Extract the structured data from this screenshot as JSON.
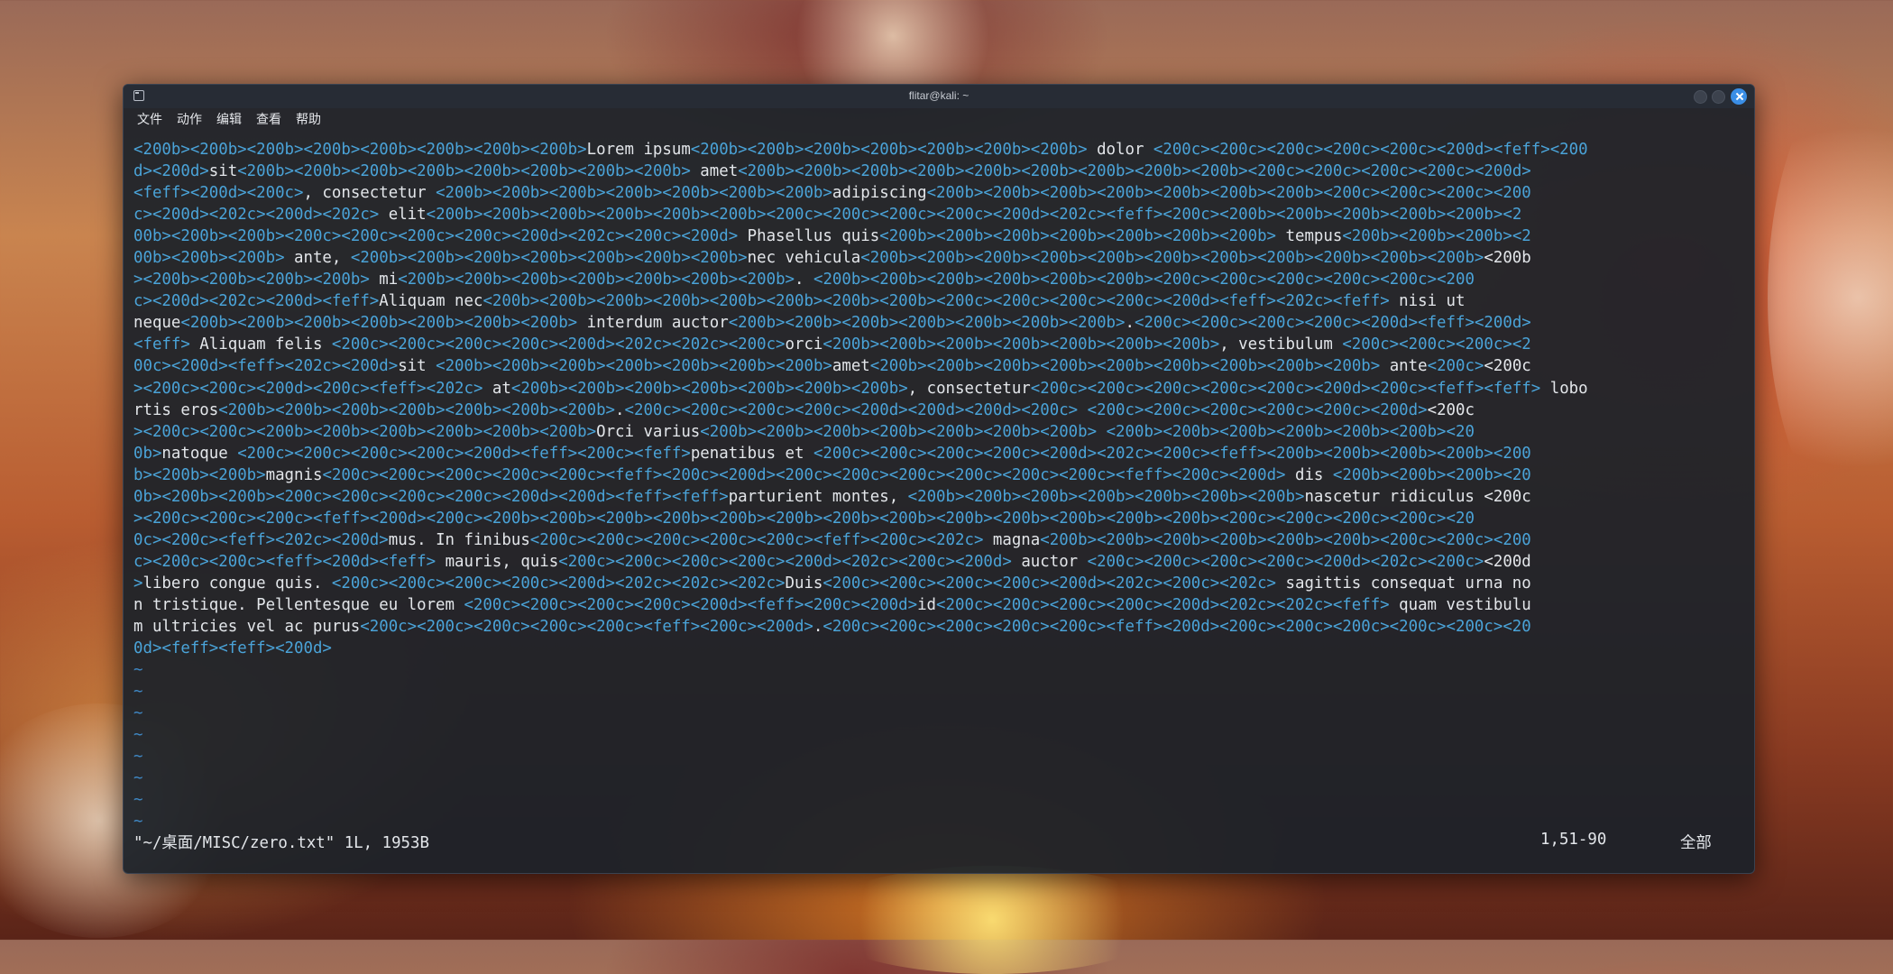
{
  "window": {
    "title": "flitar@kali: ~"
  },
  "menu": {
    "items": [
      "文件",
      "动作",
      "编辑",
      "查看",
      "帮助"
    ]
  },
  "editor": {
    "lines": [
      "<200b><200b><200b><200b><200b><200b><200b><200b>Lorem ipsum<200b><200b><200b><200b><200b><200b><200b> dolor <200c><200c><200c><200c><200c><200d><feff><200",
      "d><200d>sit<200b><200b><200b><200b><200b><200b><200b><200b> amet<200b><200b><200b><200b><200b><200b><200b><200b><200b><200c><200c><200c><200c><200d>",
      "<feff><200d><200c>, consectetur <200b><200b><200b><200b><200b><200b><200b>adipiscing<200b><200b><200b><200b><200b><200b><200b><200c><200c><200c><200",
      "c><200d><202c><200d><202c> elit<200b><200b><200b><200b><200b><200b><200c><200c><200c><200c><200d><202c><feff><200c><200b><200b><200b><200b><200b><2",
      "00b><200b><200b><200c><200c><200c><200c><200d><202c><200c><200d> Phasellus quis<200b><200b><200b><200b><200b><200b><200b> tempus<200b><200b><200b><2",
      "00b><200b><200b> ante, <200b><200b><200b><200b><200b><200b><200b>nec vehicula<200b><200b><200b><200b><200b><200b><200b><200b><200b><200b><200b><200b",
      "><200b><200b><200b><200b> mi<200b><200b><200b><200b><200b><200b><200b>. <200b><200b><200b><200b><200b><200b><200c><200c><200c><200c><200c><200",
      "c><200d><202c><200d><feff>Aliquam nec<200b><200b><200b><200b><200b><200b><200b><200b><200c><200c><200c><200c><200d><feff><202c><feff> nisi ut",
      "neque<200b><200b><200b><200b><200b><200b><200b> interdum auctor<200b><200b><200b><200b><200b><200b><200b>.<200c><200c><200c><200c><200d><feff><200d>",
      "<feff> Aliquam felis <200c><200c><200c><200c><200d><202c><202c><200c>orci<200b><200b><200b><200b><200b><200b><200b>, vestibulum <200c><200c><200c><2",
      "00c><200d><feff><202c><200d>sit <200b><200b><200b><200b><200b><200b><200b>amet<200b><200b><200b><200b><200b><200b><200b><200b><200b> ante<200c><200c",
      "><200c><200c><200d><200c><feff><202c> at<200b><200b><200b><200b><200b><200b><200b>, consectetur<200c><200c><200c><200c><200c><200d><200c><feff><feff> lobo",
      "rtis eros<200b><200b><200b><200b><200b><200b><200b>.<200c><200c><200c><200c><200d><200d><200d><200c> <200c><200c><200c><200c><200c><200d><200c",
      "><200c><200c><200b><200b><200b><200b><200b><200b>Orci varius<200b><200b><200b><200b><200b><200b><200b> <200b><200b><200b><200b><200b><200b><20",
      "0b>natoque <200c><200c><200c><200c><200d><feff><200c><feff>penatibus et <200c><200c><200c><200c><200d><202c><200c><feff><200b><200b><200b><200b><200",
      "b><200b><200b>magnis<200c><200c><200c><200c><200c><feff><200c><200d><200c><200c><200c><200c><200c><200c><feff><200c><200d> dis <200b><200b><200b><20",
      "0b><200b><200b><200c><200c><200c><200c><200d><200d><feff><feff>parturient montes, <200b><200b><200b><200b><200b><200b><200b>nascetur ridiculus <200c",
      "><200c><200c><200c><feff><200d><200c><200b><200b><200b><200b><200b><200b><200b><200b><200b><200b><200b><200b><200b><200c><200c><200c><200c><20",
      "0c><200c><feff><202c><200d>mus. In finibus<200c><200c><200c><200c><200c><feff><200c><202c> magna<200b><200b><200b><200b><200b><200b><200c><200c><200",
      "c><200c><200c><feff><200d><feff> mauris, quis<200c><200c><200c><200c><200d><202c><200c><200d> auctor <200c><200c><200c><200c><200d><202c><200c><200d",
      ">libero congue quis. <200c><200c><200c><200c><200d><202c><202c><202c>Duis<200c><200c><200c><200c><200d><202c><200c><202c> sagittis consequat urna no",
      "n tristique. Pellentesque eu lorem <200c><200c><200c><200c><200d><feff><200c><200d>id<200c><200c><200c><200c><200d><202c><202c><feff> quam vestibulu",
      "m ultricies vel ac purus<200c><200c><200c><200c><200c><feff><200c><200d>.<200c><200c><200c><200c><200c><feff><200d><200c><200c><200c><200c><200c><20",
      "0d><feff><feff><200d>"
    ],
    "cursor": {
      "line": 0,
      "char": "<"
    },
    "empty_line_marker": "~",
    "empty_line_count": 8
  },
  "status": {
    "file": "\"~/桌面/MISC/zero.txt\" 1L, 1953B",
    "position": "1,51-90",
    "scroll": "全部"
  },
  "colors": {
    "terminal_bg": "#1b2129",
    "code_highlight": "#4aa3d8",
    "text": "#e3e6ea",
    "accent": "#3a8ee6"
  }
}
